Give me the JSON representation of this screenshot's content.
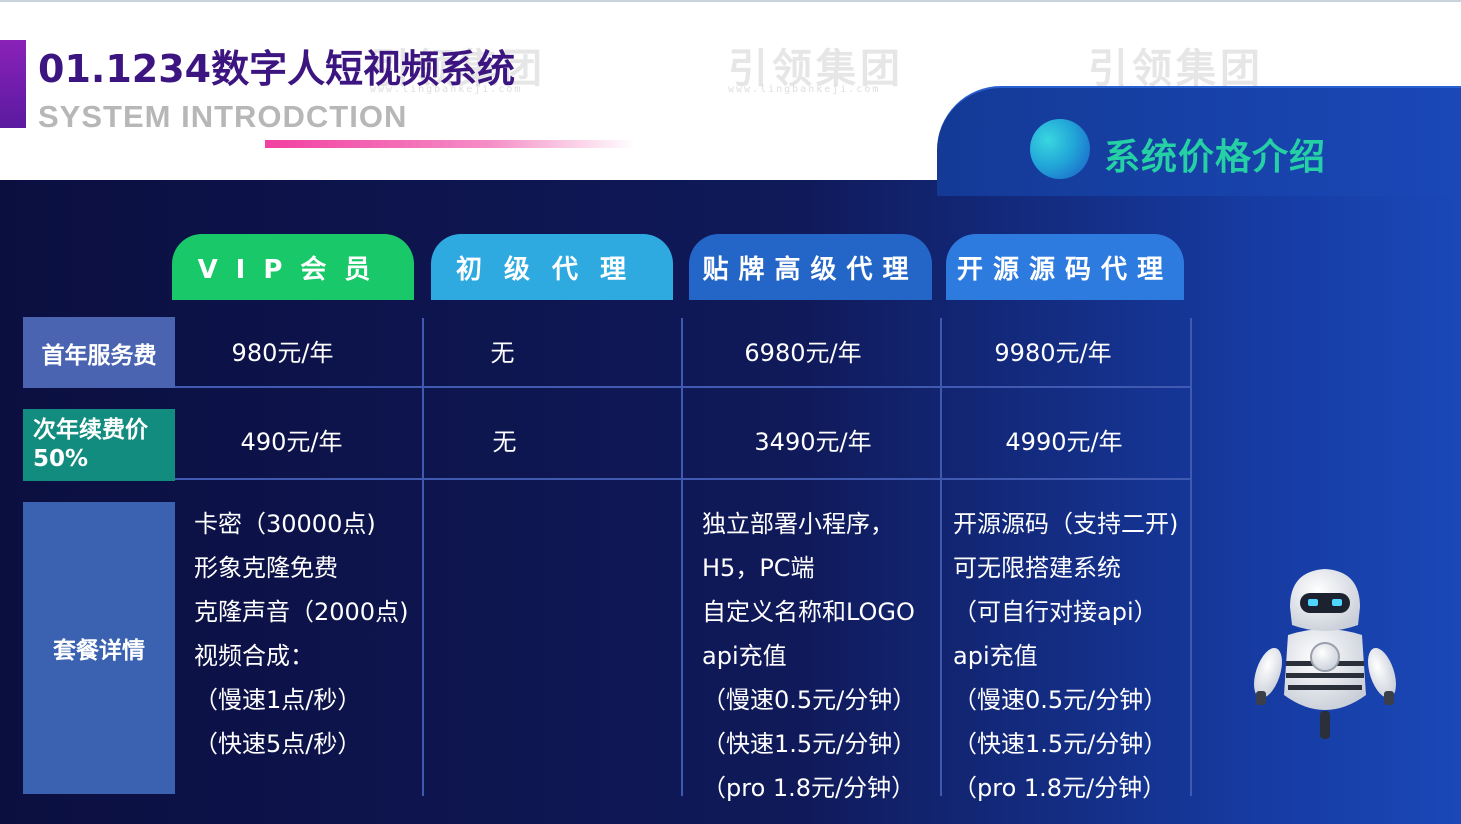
{
  "header": {
    "title": "01.1234数字人短视频系统",
    "subtitle": "SYSTEM INTRODCTION",
    "watermark": "引领集团",
    "watermark_url": "www.lingbankeji.com"
  },
  "section": {
    "title": "系统价格介绍"
  },
  "columns": [
    {
      "label": "VIP会员",
      "color": "#19c869"
    },
    {
      "label": "初级代理",
      "color": "#2eaae0"
    },
    {
      "label": "贴牌高级代理",
      "color": "#2466c8"
    },
    {
      "label": "开源源码代理",
      "color": "#2e7be0"
    }
  ],
  "rows": {
    "first_year": {
      "label": "首年服务费",
      "values": [
        "980元/年",
        "无",
        "6980元/年",
        "9980元/年"
      ]
    },
    "renewal": {
      "label_line1": "次年续费价",
      "label_line2": "50%",
      "values": [
        "490元/年",
        "无",
        "3490元/年",
        "4990元/年"
      ]
    },
    "package": {
      "label": "套餐详情",
      "vip": [
        "卡密（30000点)",
        "形象克隆免费",
        "克隆声音（2000点)",
        "视频合成：",
        "（慢速1点/秒）",
        "（快速5点/秒）"
      ],
      "oem": [
        "独立部署小程序，",
        "H5，PC端",
        "自定义名称和LOGO",
        "api充值",
        "（慢速0.5元/分钟）",
        "（快速1.5元/分钟）",
        "（pro 1.8元/分钟）"
      ],
      "source": [
        "开源源码（支持二开)",
        "可无限搭建系统",
        "（可自行对接api）",
        "api充值",
        "（慢速0.5元/分钟）",
        "（快速1.5元/分钟）",
        "（pro 1.8元/分钟）"
      ]
    }
  },
  "colors": {
    "title": "#3d1580",
    "section_title": "#25d0a5",
    "panel_dark": "#0b0f40",
    "panel_light": "#1a48b8"
  },
  "icons": [
    "robot-illustration",
    "gradient-orb-icon"
  ]
}
